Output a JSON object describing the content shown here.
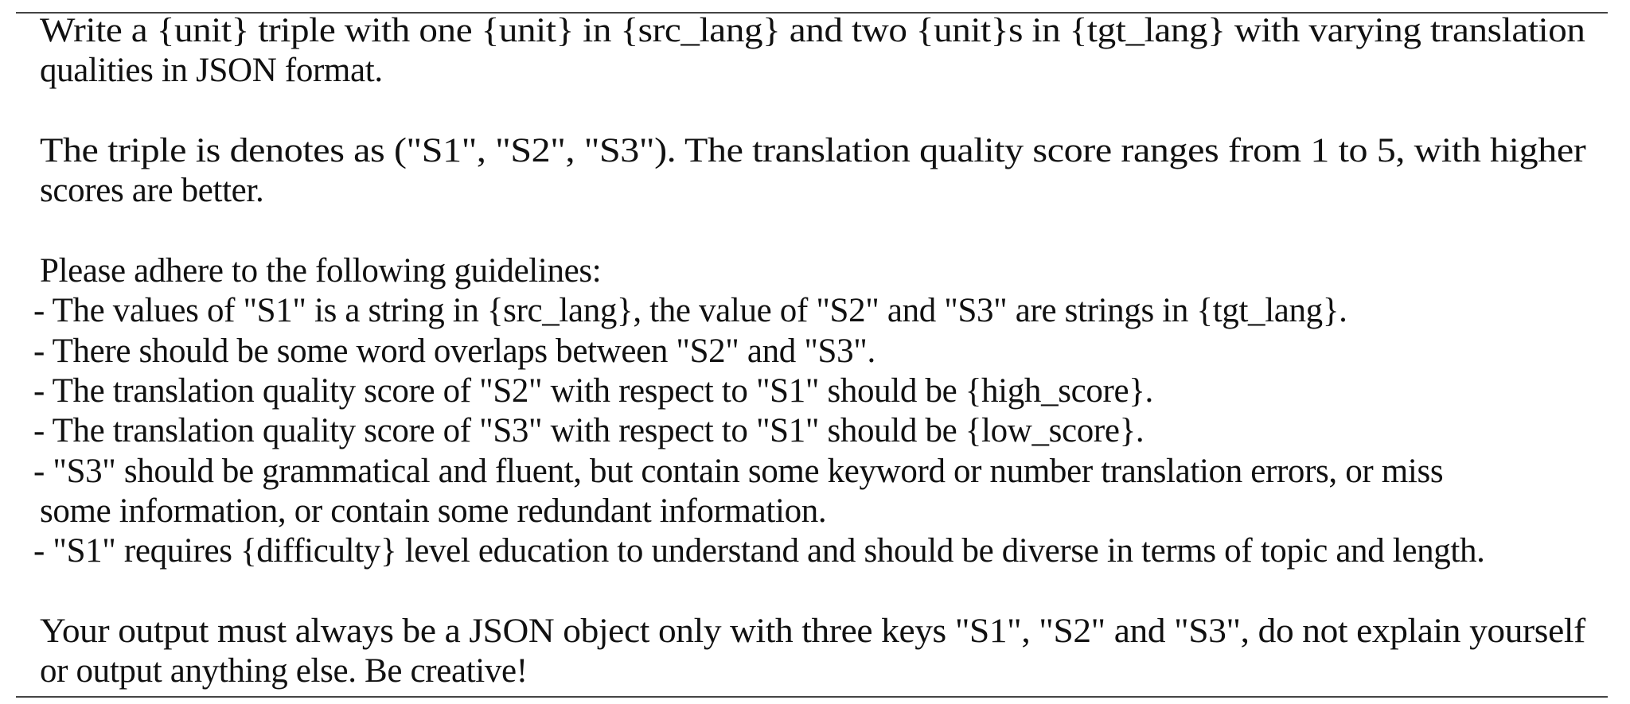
{
  "prompt": {
    "paragraphs": [
      {
        "lines": [
          "Write a {unit} triple with one {unit} in {src_lang} and two {unit}s in {tgt_lang} with varying translation",
          "qualities in JSON format."
        ]
      },
      {
        "lines": [
          "The triple is denotes as (\"S1\", \"S2\", \"S3\").  The translation quality score ranges from 1 to 5, with higher",
          "scores are better."
        ]
      },
      {
        "lines": [
          "Please adhere to the following guidelines:"
        ]
      }
    ],
    "guidelines": [
      "- The values of \"S1\" is a string in {src_lang}, the value of \"S2\" and \"S3\" are strings in {tgt_lang}.",
      "- There should be some word overlaps between \"S2\" and \"S3\".",
      "- The translation quality score of \"S2\" with respect to \"S1\" should be {high_score}.",
      "- The translation quality score of \"S3\" with respect to \"S1\" should be {low_score}.",
      "- \"S3\" should be grammatical and fluent, but contain some keyword or number translation errors, or miss",
      "some information, or contain some redundant information.",
      "- \"S1\" requires {difficulty} level education to understand and should be diverse in terms of topic and length."
    ],
    "closing": [
      "Your output must always be a JSON object only with three keys \"S1\", \"S2\" and \"S3\", do not explain yourself",
      "or output anything else.  Be creative!"
    ]
  }
}
